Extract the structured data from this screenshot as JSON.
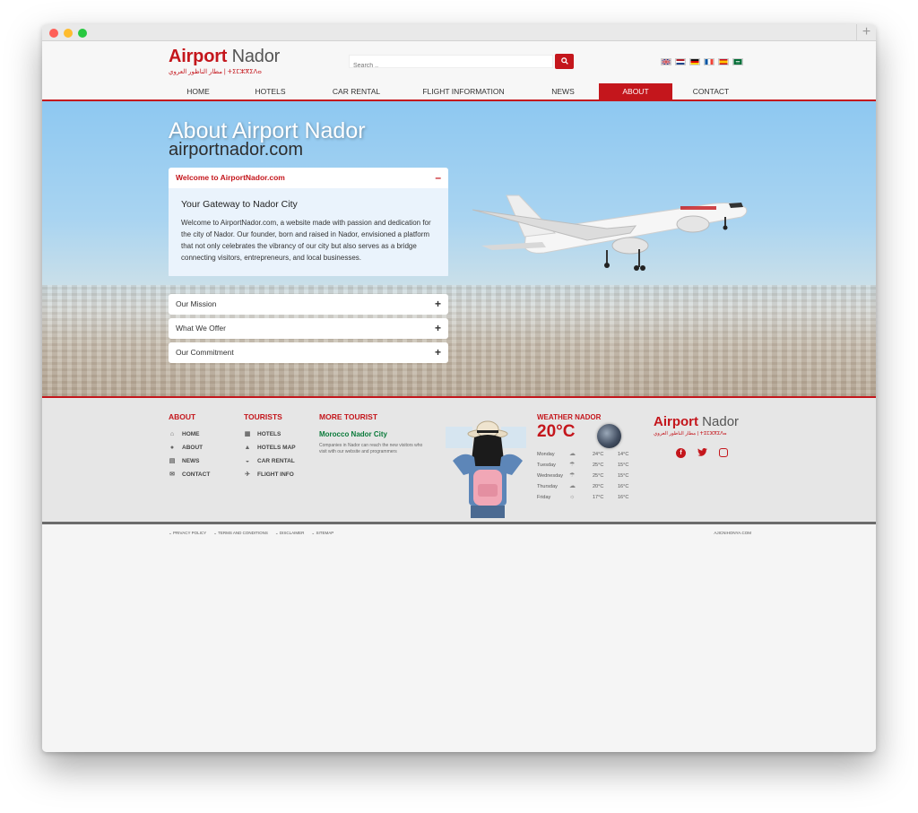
{
  "header": {
    "logo_main": "Airport",
    "logo_accent": "Nador",
    "logo_arabic": "مطار الناظور العروي | ⵜⵉⵎⵣⴳⵉⴷⴰ",
    "search_placeholder": "Search ..",
    "flags": [
      "gb",
      "nl",
      "de",
      "fr",
      "es",
      "sa"
    ]
  },
  "nav": {
    "items": [
      {
        "label": "HOME",
        "active": false
      },
      {
        "label": "HOTELS",
        "active": false
      },
      {
        "label": "CAR RENTAL",
        "active": false
      },
      {
        "label": "FLIGHT INFORMATION",
        "active": false
      },
      {
        "label": "NEWS",
        "active": false
      },
      {
        "label": "ABOUT",
        "active": true
      },
      {
        "label": "CONTACT",
        "active": false
      }
    ]
  },
  "hero": {
    "title": "About Airport Nador",
    "subtitle": "airportnador.com",
    "accordion": [
      {
        "label": "Welcome to AirportNador.com",
        "open": true,
        "heading": "Your Gateway to Nador City",
        "body": "Welcome to AirportNador.com, a website made with passion and dedication for the city of Nador. Our founder, born and raised in Nador, envisioned a platform that not only celebrates the vibrancy of our city but also serves as a bridge connecting visitors, entrepreneurs, and local businesses."
      },
      {
        "label": "Our Mission",
        "open": false
      },
      {
        "label": "What We Offer",
        "open": false
      },
      {
        "label": "Our Commitment",
        "open": false
      }
    ]
  },
  "footer": {
    "about": {
      "title": "ABOUT",
      "items": [
        {
          "label": "HOME",
          "icon": "home-icon"
        },
        {
          "label": "ABOUT",
          "icon": "info-icon"
        },
        {
          "label": "NEWS",
          "icon": "newspaper-icon"
        },
        {
          "label": "CONTACT",
          "icon": "envelope-icon"
        }
      ]
    },
    "tourists": {
      "title": "TOURISTS",
      "items": [
        {
          "label": "HOTELS",
          "icon": "building-icon"
        },
        {
          "label": "HOTELS MAP",
          "icon": "map-icon"
        },
        {
          "label": "CAR RENTAL",
          "icon": "car-icon"
        },
        {
          "label": "FLIGHT INFO",
          "icon": "plane-icon"
        }
      ]
    },
    "more": {
      "title": "MORE TOURIST",
      "subtitle": "Morocco Nador City",
      "text": "Companies in Nador can reach the new visitors who visit with our website and programmers"
    },
    "weather": {
      "title": "WEATHER NADOR",
      "temp": "20°C",
      "days": [
        {
          "day": "Monday",
          "high": "24°C",
          "low": "14°C",
          "icon": "cloud-icon"
        },
        {
          "day": "Tuesday",
          "high": "25°C",
          "low": "15°C",
          "icon": "rain-icon"
        },
        {
          "day": "Wednesday",
          "high": "25°C",
          "low": "15°C",
          "icon": "rain-icon"
        },
        {
          "day": "Thursday",
          "high": "20°C",
          "low": "16°C",
          "icon": "cloud-icon"
        },
        {
          "day": "Friday",
          "high": "17°C",
          "low": "16°C",
          "icon": "sun-icon"
        }
      ]
    },
    "logo_main": "Airport",
    "logo_accent": "Nador",
    "logo_arabic": "مطار الناظور العروي | ⵜⵉⵎⵣⴳⵉⴷⴰ",
    "social": [
      "f",
      "t",
      "ig"
    ]
  },
  "legal": {
    "links": [
      "PRIVACY POLICY",
      "TERMS AND CONDITIONS",
      "DISCLAIMER",
      "SITEMAP"
    ],
    "copyright": "AJICNIHONYA.COM"
  },
  "colors": {
    "accent": "#c4161c",
    "green": "#0a7a3a"
  }
}
